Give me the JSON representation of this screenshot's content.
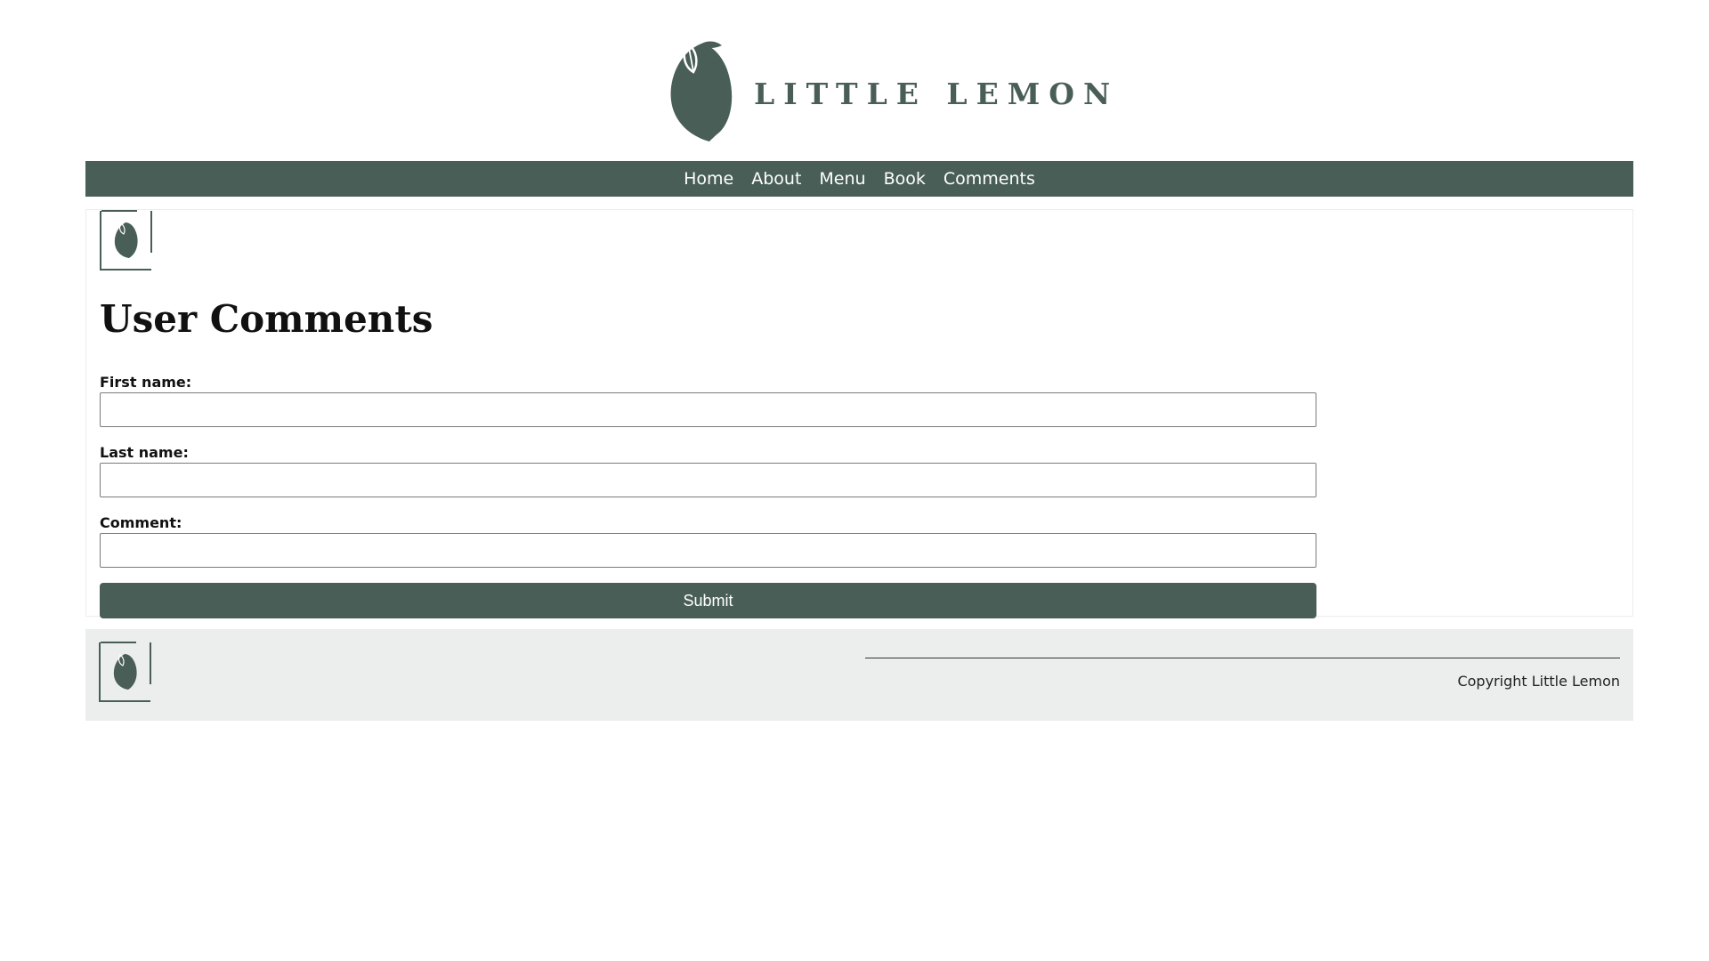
{
  "header": {
    "brand_name": "LITTLE LEMON",
    "logo_icon": "lemon-icon"
  },
  "nav": {
    "items": [
      {
        "label": "Home"
      },
      {
        "label": "About"
      },
      {
        "label": "Menu"
      },
      {
        "label": "Book"
      },
      {
        "label": "Comments"
      }
    ]
  },
  "main": {
    "title": "User Comments",
    "form": {
      "first_name_label": "First name:",
      "first_name_value": "",
      "last_name_label": "Last name:",
      "last_name_value": "",
      "comment_label": "Comment:",
      "comment_value": "",
      "submit_label": "Submit"
    }
  },
  "footer": {
    "copyright": "Copyright Little Lemon"
  },
  "colors": {
    "primary": "#495e57",
    "footer_bg": "#ebeeed",
    "background": "#ffffff"
  }
}
